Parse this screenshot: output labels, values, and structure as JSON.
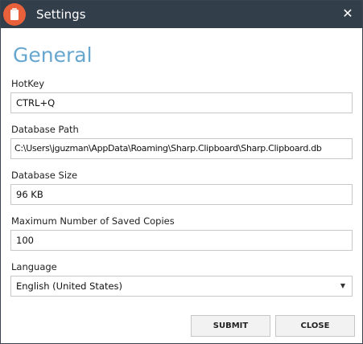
{
  "window": {
    "title": "Settings",
    "close_glyph": "✕",
    "close_icon": "close-icon",
    "app_icon": "clipboard-icon",
    "titlebar_color": "#323e4a",
    "app_icon_color": "#e8613a"
  },
  "section": {
    "title": "General",
    "title_color": "#67a6cf"
  },
  "fields": {
    "hotkey": {
      "label": "HotKey",
      "value": "CTRL+Q"
    },
    "database_path": {
      "label": "Database Path",
      "value": "C:\\Users\\jguzman\\AppData\\Roaming\\Sharp.Clipboard\\Sharp.Clipboard.db"
    },
    "database_size": {
      "label": "Database Size",
      "value": "96 KB"
    },
    "max_copies": {
      "label": "Maximum Number of Saved Copies",
      "value": "100"
    },
    "language": {
      "label": "Language",
      "selected": "English (United States)",
      "arrow_glyph": "▼"
    }
  },
  "buttons": {
    "submit": "SUBMIT",
    "close": "CLOSE"
  }
}
